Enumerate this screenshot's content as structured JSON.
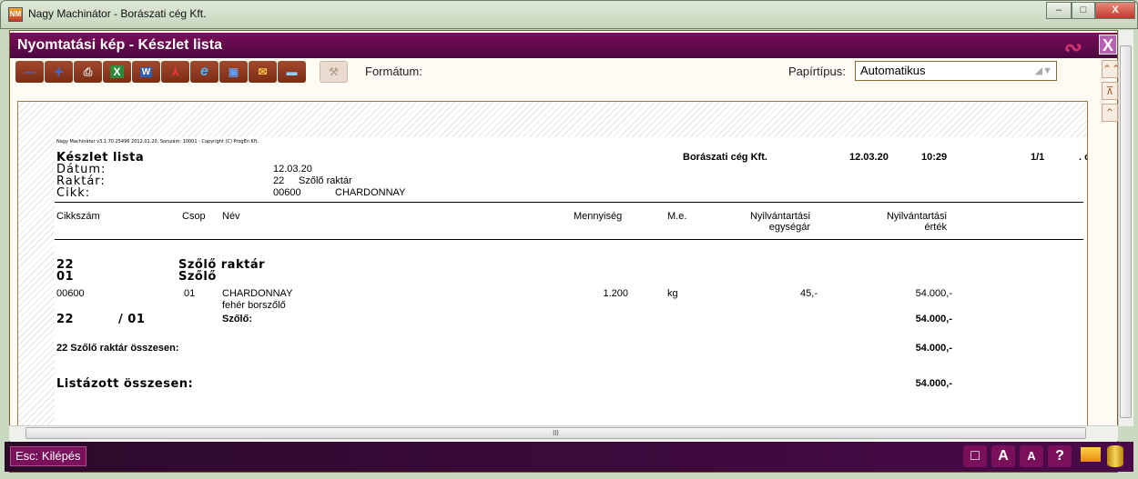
{
  "window": {
    "title": "Nagy Machinátor - Borászati cég Kft.",
    "app_icon": "NM",
    "minimize": "–",
    "maximize": "□",
    "close": "X"
  },
  "dialog": {
    "title": "Nyomtatási kép - Készlet lista",
    "close": "X",
    "swirl": "∾"
  },
  "toolbar": {
    "buttons": [
      {
        "icon": "zoom-out-icon",
        "glyph": "—"
      },
      {
        "icon": "zoom-in-icon",
        "glyph": "+"
      },
      {
        "icon": "print-icon",
        "glyph": "⎙"
      },
      {
        "icon": "excel-icon",
        "glyph": "X"
      },
      {
        "icon": "word-icon",
        "glyph": "W"
      },
      {
        "icon": "pdf-icon",
        "glyph": "⅄"
      },
      {
        "icon": "internet-explorer-icon",
        "glyph": "e"
      },
      {
        "icon": "monitor-icon",
        "glyph": "▣"
      },
      {
        "icon": "outlook-icon",
        "glyph": "✉"
      },
      {
        "icon": "save-icon",
        "glyph": "▬"
      }
    ],
    "settings_glyph": "⚒",
    "format_label": "Formátum:",
    "paper_label": "Papírtípus:",
    "paper_value": "Automatikus"
  },
  "nav": {
    "first": "⌃⌃",
    "top": "⊼",
    "up": "⌃"
  },
  "report": {
    "copyright": "Nagy Machinátor v3.1.70.25496 2012.01.20. Sorszám: 10001 - Copyright (C) ProgEn Kft.",
    "title": "Készlet lista",
    "company": "Borászati cég Kft.",
    "date": "12.03.20",
    "time": "10:29",
    "page": "1/1",
    "trail": ". c",
    "date_label": "Dátum:",
    "date_value": "12.03.20",
    "warehouse_label": "Raktár:",
    "warehouse_code": "22",
    "warehouse_name": "Szőlő raktár",
    "item_label": "Cikk:",
    "item_code": "00600",
    "item_name": "CHARDONNAY",
    "columns": {
      "code": "Cikkszám",
      "group": "Csop",
      "name": "Név",
      "qty": "Mennyiség",
      "unit": "M.e.",
      "price1": "Nyilvántartási",
      "price2": "egységár",
      "value1": "Nyilvántartási",
      "value2": "érték"
    },
    "group_wh_code": "22",
    "group_wh_name": "Szőlő raktár",
    "group_code": "01",
    "group_name": "Szőlő",
    "row": {
      "code": "00600",
      "group": "01",
      "name": "CHARDONNAY",
      "desc": "fehér borszőlő",
      "qty": "1.200",
      "unit": "kg",
      "price": "45,-",
      "value": "54.000,-"
    },
    "sub_wh": "22",
    "sub_group": "/ 01",
    "sub_label": "Szőlő:",
    "sub_value": "54.000,-",
    "wh_total_label": "22 Szőlő raktár összesen:",
    "wh_total_value": "54.000,-",
    "grand_label": "Listázott összesen:",
    "grand_value": "54.000,-"
  },
  "hscroll_grip": "III",
  "bottom": {
    "esc": "Esc: Kilépés",
    "buttons": [
      "□",
      "A",
      "A",
      "?"
    ]
  }
}
